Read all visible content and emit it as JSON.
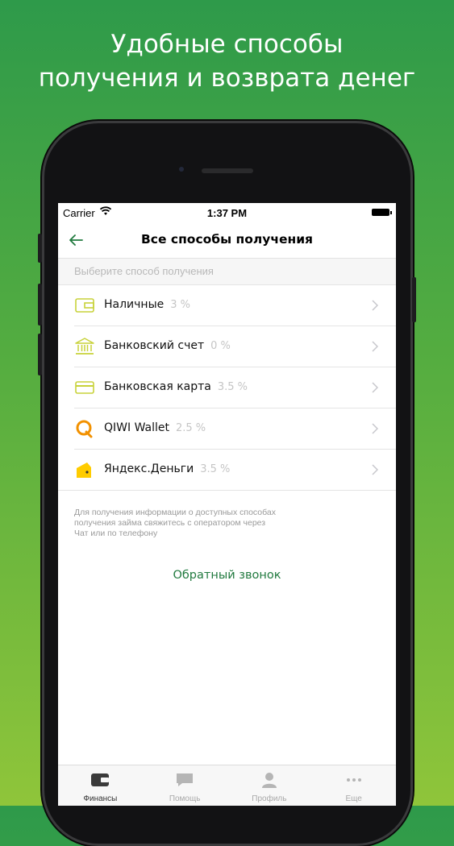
{
  "headline": {
    "line1": "Удобные способы",
    "line2": "получения и возврата денег"
  },
  "status_bar": {
    "carrier": "Carrier",
    "time": "1:37 PM"
  },
  "nav": {
    "title": "Все способы получения"
  },
  "section_header": "Выберите способ получения",
  "methods": [
    {
      "name": "Наличные",
      "fee": "3 %",
      "icon": "cash-wallet-icon"
    },
    {
      "name": "Банковский счет",
      "fee": "0 %",
      "icon": "bank-icon"
    },
    {
      "name": "Банковская карта",
      "fee": "3.5 %",
      "icon": "card-icon"
    },
    {
      "name": "QIWI Wallet",
      "fee": "2.5 %",
      "icon": "qiwi-icon"
    },
    {
      "name": "Яндекс.Деньги",
      "fee": "3.5 %",
      "icon": "yandex-money-icon"
    }
  ],
  "info_note": {
    "line1": "Для получения информации о доступных способах",
    "line2": "получения займа свяжитесь с оператором через",
    "line3": "Чат или по телефону"
  },
  "callback_label": "Обратный звонок",
  "tabs": [
    {
      "label": "Финансы",
      "icon": "wallet-icon",
      "active": true
    },
    {
      "label": "Помощь",
      "icon": "chat-bubble-icon",
      "active": false
    },
    {
      "label": "Профиль",
      "icon": "person-icon",
      "active": false
    },
    {
      "label": "Еще",
      "icon": "more-dots-icon",
      "active": false
    }
  ],
  "colors": {
    "background_top": "#2e9a4a",
    "background_bottom": "#8fc53a",
    "accent_green": "#217a3f",
    "icon_yellow_green": "#c8d23a",
    "qiwi_orange": "#f29100",
    "yandex_yellow": "#ffcc00"
  }
}
